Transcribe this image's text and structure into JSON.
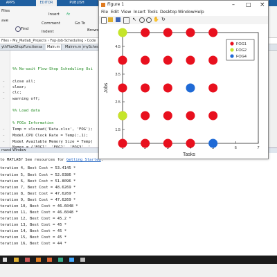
{
  "ribbon": {
    "tabs": [
      "APPS",
      "EDITOR",
      "PUBLISH"
    ],
    "buttons": {
      "files": "Files",
      "ave": "ave",
      "find": "Find",
      "insert": "Insert",
      "fx": "fx",
      "comment": "Comment",
      "indent": "Indent",
      "go_to": "Go To",
      "browse": "Browse"
    }
  },
  "path": "itor - D:\\Files\\My_Matlab_Projects\\Fop-Job-Scheduling\\Code",
  "breadcrumbs": [
    "Files",
    "My_Matlab_Projects",
    "Fop-Job-Scheduling",
    "Code"
  ],
  "file_tabs": [
    "ythFlowShopFunctionsa",
    "Main.m",
    "Mainm.m",
    "mySchedulingFu"
  ],
  "editor": {
    "lines": [
      {
        "text": "%% No-wait Flow-Shop Scheduling Usi",
        "kind": "comment"
      },
      {
        "text": "close all;",
        "kind": "code"
      },
      {
        "text": "clear;",
        "kind": "code"
      },
      {
        "text": "clc;",
        "kind": "code"
      },
      {
        "text": "warning off;",
        "kind": "code"
      },
      {
        "text": "%% Load data",
        "kind": "comment"
      },
      {
        "text": "% FOGs Information",
        "kind": "comment"
      },
      {
        "text": "Temp = xlsread('Data.xlsx', 'FOG');",
        "kind": "code"
      },
      {
        "text": "Model.CPU Clock Rate = Temp(:,1);",
        "kind": "code"
      },
      {
        "text": "Model Available Memory Size = Temp(",
        "kind": "code"
      },
      {
        "text": "Names = {'FOG1', 'FOG2', 'FOG3', '",
        "kind": "code"
      }
    ]
  },
  "command_window": {
    "title": "mand Window",
    "notice_prefix": "to MATLAB? See resources for ",
    "notice_link": "Getting Started",
    "lines": [
      "teration 4, Best Cost = 53.4145 *",
      "teration 5, Best Cost = 52.0386 *",
      "teration 6, Best Cost = 51.8096 *",
      "teration 7, Best Cost = 48.6269 *",
      "teration 8, Best Cost = 47.6269 *",
      "teration 9, Best Cost = 47.6269 *",
      "teration 10, Best Cost = 46.6048 *",
      "teration 11, Best Cost = 46.6048 *",
      "teration 12, Best Cost = 45.2 *",
      "teration 13, Best Cost = 45 *",
      "teration 14, Best Cost = 45 *",
      "teration 15, Best Cost = 45 *",
      "teration 16, Best Cost = 44 *"
    ]
  },
  "figure": {
    "title": "Figure 1",
    "menu": [
      "File",
      "Edit",
      "View",
      "Insert",
      "Tools",
      "Desktop",
      "Window",
      "Help"
    ],
    "controls": {
      "minimize": "–",
      "maximize": "□",
      "close": "×"
    }
  },
  "colors": {
    "FOG1": "#e8101e",
    "FOG2": "#c5e52a",
    "FOG3": "#1f6ad6",
    "ribbon_blue": "#1f5fa0",
    "comment_green": "#228b22"
  },
  "taskbar": {
    "icons": [
      "windows-icon",
      "folder-icon",
      "matlab-icon",
      "app-icon",
      "app-icon",
      "app-icon",
      "app-icon",
      "app-icon"
    ]
  },
  "chart_data": {
    "type": "scatter",
    "title": "",
    "xlabel": "Tasks",
    "ylabel": "Jobs",
    "xlim": [
      1,
      7
    ],
    "ylim": [
      1,
      5
    ],
    "xticks": [
      "1",
      "2",
      "3",
      "4",
      "5",
      "6",
      "7"
    ],
    "yticks": [
      "1.5",
      "2",
      "2.5",
      "3",
      "3.5",
      "4",
      "4.5"
    ],
    "legend": {
      "placement": "top-right",
      "entries": [
        "FOG1",
        "FOG2",
        "FOG4"
      ]
    },
    "series": [
      {
        "name": "FOG1",
        "color": "#e8101e",
        "points": [
          [
            1,
            1
          ],
          [
            2,
            1
          ],
          [
            3,
            1
          ],
          [
            4,
            1
          ],
          [
            1,
            2
          ],
          [
            2,
            2
          ],
          [
            3,
            2
          ],
          [
            4,
            2
          ],
          [
            5,
            2
          ],
          [
            1,
            3
          ],
          [
            2,
            3
          ],
          [
            3,
            3
          ],
          [
            5,
            3
          ],
          [
            1,
            4
          ],
          [
            2,
            4
          ],
          [
            3,
            4
          ],
          [
            4,
            4
          ],
          [
            5,
            4
          ],
          [
            2,
            5
          ],
          [
            3,
            5
          ],
          [
            4,
            5
          ],
          [
            5,
            5
          ]
        ]
      },
      {
        "name": "FOG2",
        "color": "#c5e52a",
        "points": [
          [
            1,
            2
          ],
          [
            1,
            5
          ]
        ]
      },
      {
        "name": "FOG4",
        "color": "#1f6ad6",
        "points": [
          [
            4,
            3
          ],
          [
            5,
            1
          ]
        ]
      }
    ]
  }
}
